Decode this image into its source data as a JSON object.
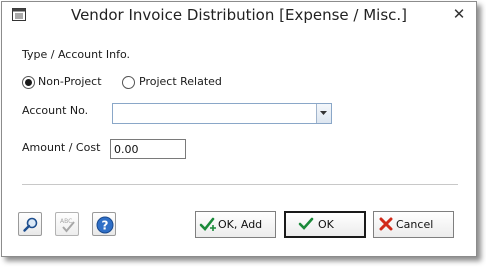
{
  "window": {
    "title": "Vendor Invoice Distribution [Expense / Misc.]"
  },
  "form": {
    "section_label": "Type / Account Info.",
    "radio_non_project": "Non-Project",
    "radio_project_related": "Project Related",
    "selected_type": "Non-Project",
    "account_label": "Account No.",
    "account_value": "",
    "amount_label": "Amount / Cost",
    "amount_value": "0.00"
  },
  "toolbar": {
    "search_icon": "magnifier-icon",
    "spellcheck_icon": "abc-check-icon",
    "help_icon": "question-icon"
  },
  "buttons": {
    "ok_add": "OK, Add",
    "ok": "OK",
    "cancel": "Cancel"
  }
}
